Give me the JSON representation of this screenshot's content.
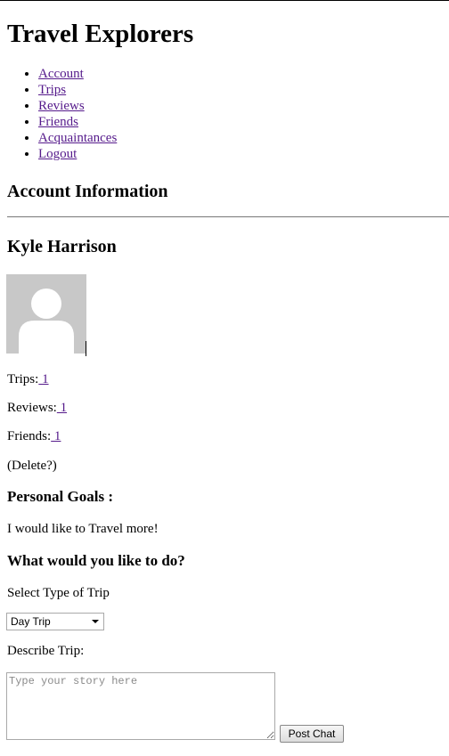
{
  "app": {
    "title": "Travel Explorers"
  },
  "nav": {
    "items": [
      {
        "label": "Account"
      },
      {
        "label": "Trips"
      },
      {
        "label": "Reviews"
      },
      {
        "label": "Friends"
      },
      {
        "label": "Acquaintances"
      },
      {
        "label": "Logout"
      }
    ]
  },
  "account": {
    "heading": "Account Information",
    "name": "Kyle Harrison",
    "avatar_icon": "default-user-avatar-icon",
    "trips_label": "Trips:",
    "trips_count": " 1",
    "reviews_label": "Reviews:",
    "reviews_count": " 1",
    "friends_label": "Friends:",
    "friends_count": " 1",
    "delete_text": "(Delete?)"
  },
  "goals": {
    "heading": "Personal Goals :",
    "text": "I would like to Travel more!"
  },
  "actions": {
    "heading": "What would you like to do?",
    "select_label": "Select Type of Trip",
    "selected_trip_type": "Day Trip",
    "describe_label": "Describe Trip:",
    "story_placeholder": "Type your story here",
    "post_button": "Post Chat"
  }
}
